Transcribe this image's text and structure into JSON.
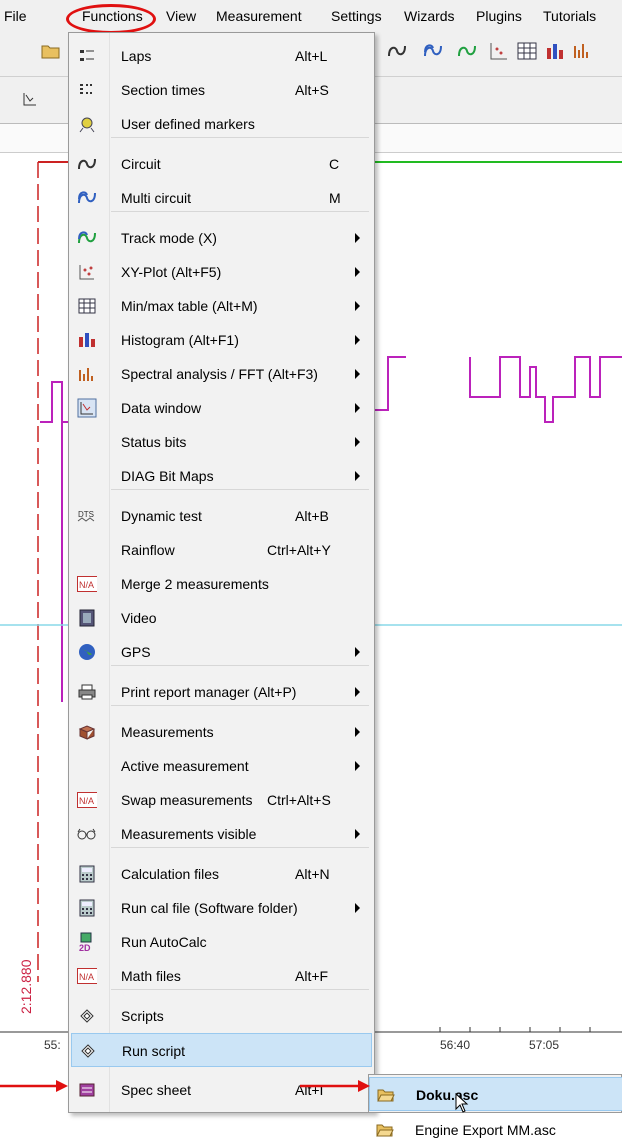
{
  "menubar": {
    "items": [
      "File",
      "Functions",
      "View",
      "Measurement",
      "Settings",
      "Wizards",
      "Plugins",
      "Tutorials"
    ]
  },
  "functions_menu": {
    "items": [
      {
        "label": "Laps",
        "shortcut": "Alt+L",
        "submenu": false,
        "icon": "laps-icon"
      },
      {
        "label": "Section times",
        "shortcut": "Alt+S",
        "submenu": false,
        "icon": "section-times-icon"
      },
      {
        "label": "User defined markers",
        "shortcut": "",
        "submenu": false,
        "icon": "markers-icon"
      },
      {
        "label": "Circuit",
        "shortcut": "C",
        "submenu": false,
        "icon": "circuit-icon"
      },
      {
        "label": "Multi circuit",
        "shortcut": "M",
        "submenu": false,
        "icon": "multi-circuit-icon"
      },
      {
        "label": "Track mode (X)",
        "shortcut": "",
        "submenu": true,
        "icon": "track-mode-icon"
      },
      {
        "label": "XY-Plot (Alt+F5)",
        "shortcut": "",
        "submenu": true,
        "icon": "xy-plot-icon"
      },
      {
        "label": "Min/max table (Alt+M)",
        "shortcut": "",
        "submenu": true,
        "icon": "minmax-table-icon"
      },
      {
        "label": "Histogram (Alt+F1)",
        "shortcut": "",
        "submenu": true,
        "icon": "histogram-icon"
      },
      {
        "label": "Spectral analysis / FFT (Alt+F3)",
        "shortcut": "",
        "submenu": true,
        "icon": "fft-icon"
      },
      {
        "label": "Data window",
        "shortcut": "",
        "submenu": true,
        "icon": "data-window-icon"
      },
      {
        "label": "Status bits",
        "shortcut": "",
        "submenu": true,
        "icon": ""
      },
      {
        "label": "DIAG Bit Maps",
        "shortcut": "",
        "submenu": true,
        "icon": ""
      },
      {
        "label": "Dynamic test",
        "shortcut": "Alt+B",
        "submenu": false,
        "icon": "dynamic-test-icon"
      },
      {
        "label": "Rainflow",
        "shortcut": "Ctrl+Alt+Y",
        "submenu": false,
        "icon": ""
      },
      {
        "label": "Merge 2 measurements",
        "shortcut": "",
        "submenu": false,
        "icon": "na-icon"
      },
      {
        "label": "Video",
        "shortcut": "",
        "submenu": false,
        "icon": "video-icon"
      },
      {
        "label": "GPS",
        "shortcut": "",
        "submenu": true,
        "icon": "globe-icon"
      },
      {
        "label": "Print report manager (Alt+P)",
        "shortcut": "",
        "submenu": true,
        "icon": "printer-icon"
      },
      {
        "label": "Measurements",
        "shortcut": "",
        "submenu": true,
        "icon": "measurements-icon"
      },
      {
        "label": "Active measurement",
        "shortcut": "",
        "submenu": true,
        "icon": ""
      },
      {
        "label": "Swap measurements",
        "shortcut": "Ctrl+Alt+S",
        "submenu": false,
        "icon": "na-icon"
      },
      {
        "label": "Measurements visible",
        "shortcut": "",
        "submenu": true,
        "icon": "glasses-icon"
      },
      {
        "label": "Calculation files",
        "shortcut": "Alt+N",
        "submenu": false,
        "icon": "calculator-icon"
      },
      {
        "label": "Run cal file (Software folder)",
        "shortcut": "",
        "submenu": true,
        "icon": "calculator-icon"
      },
      {
        "label": "Run AutoCalc",
        "shortcut": "",
        "submenu": false,
        "icon": "autocalc-icon"
      },
      {
        "label": "Math files",
        "shortcut": "Alt+F",
        "submenu": false,
        "icon": "na-icon"
      },
      {
        "label": "Scripts",
        "shortcut": "",
        "submenu": false,
        "icon": "script-icon"
      },
      {
        "label": "Run script",
        "shortcut": "",
        "submenu": false,
        "icon": "script-icon"
      },
      {
        "label": "Spec sheet",
        "shortcut": "Alt+I",
        "submenu": false,
        "icon": "spec-sheet-icon"
      }
    ]
  },
  "run_script_submenu": {
    "items": [
      {
        "label": "Doku.asc",
        "icon": "folder-open-icon"
      },
      {
        "label": "Engine Export MM.asc",
        "icon": "folder-open-icon"
      }
    ]
  },
  "plot": {
    "vertical_value": "2:12.880",
    "x_ticks": [
      "55:",
      "56:40",
      "57:05"
    ]
  },
  "colors": {
    "highlight": "#e01010",
    "active_item": "#cce4f7",
    "trace_green": "#22bb22",
    "trace_magenta": "#bb22bb",
    "trace_red": "#cc2222",
    "trace_cyan": "#88d8e8"
  }
}
